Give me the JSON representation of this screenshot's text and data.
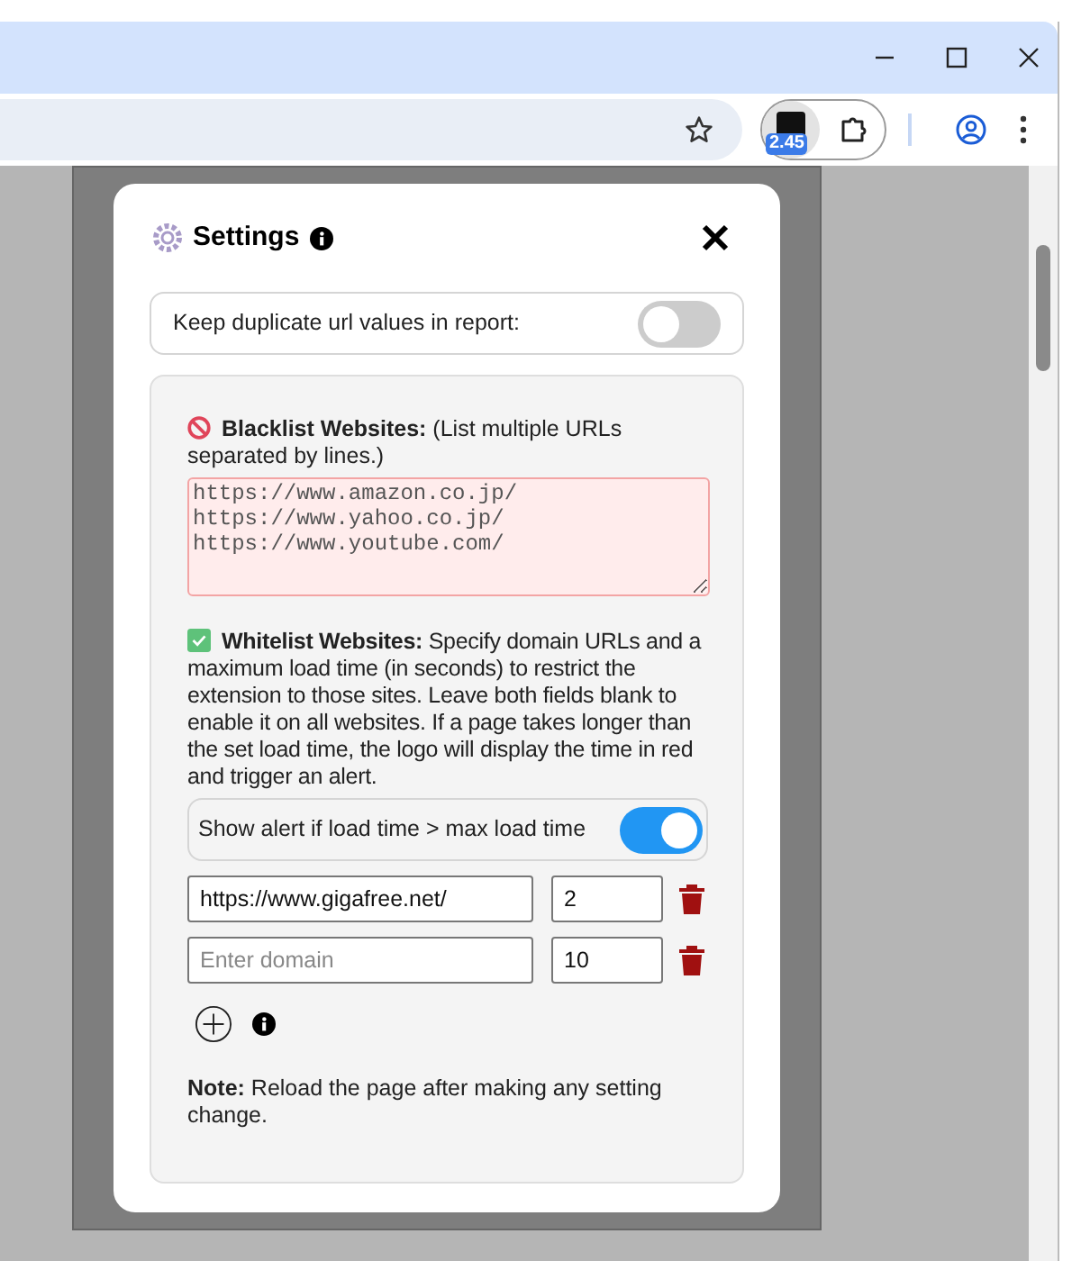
{
  "browser": {
    "extension_badge": "2.45"
  },
  "modal": {
    "title": "Settings",
    "duplicate_toggle": {
      "label": "Keep duplicate url values in report:",
      "on": false
    },
    "blacklist": {
      "text": "**Blacklist Websites:** (List multiple URLs separated by lines.)",
      "value": "https://www.amazon.co.jp/\nhttps://www.yahoo.co.jp/\nhttps://www.youtube.com/"
    },
    "whitelist": {
      "text": "**Whitelist Websites:** Specify domain URLs and a maximum load time (in seconds) to restrict the extension to those sites. Leave both fields blank to enable it on all websites. If a page takes longer than the set load time, the logo will display the time in red and trigger an alert.",
      "alert_toggle": {
        "label": "Show alert if load time > max load time",
        "on": true
      },
      "entries": [
        {
          "domain": "https://www.gigafree.net/",
          "max_load_time": "2"
        },
        {
          "placeholder": "Enter domain",
          "max_load_time": "10"
        }
      ]
    },
    "note": "**Note:** Reload the page after making any setting change."
  }
}
